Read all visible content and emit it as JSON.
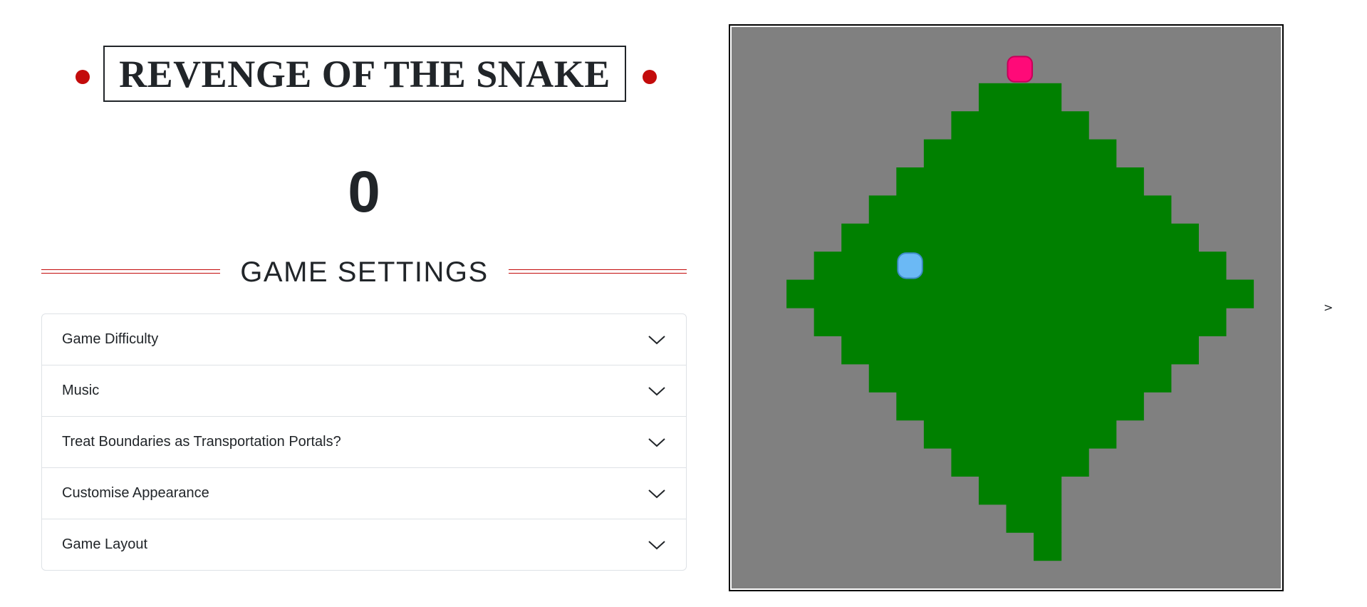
{
  "title": "REVENGE OF THE SNAKE",
  "score": "0",
  "settings": {
    "heading": "GAME SETTINGS",
    "items": [
      {
        "label": "Game Difficulty"
      },
      {
        "label": "Music"
      },
      {
        "label": "Treat Boundaries as Transportation Portals?"
      },
      {
        "label": "Customise Appearance"
      },
      {
        "label": "Game Layout"
      }
    ]
  },
  "board": {
    "cols": 20,
    "rows": 20,
    "background_color": "#808080",
    "snake_color": "#008000",
    "food_color": "#ff0a78",
    "player_color": "#6bb9f5",
    "snake_run_rows": [
      {
        "row": 2,
        "start": 9,
        "end": 11
      },
      {
        "row": 3,
        "start": 8,
        "end": 12
      },
      {
        "row": 4,
        "start": 7,
        "end": 13
      },
      {
        "row": 5,
        "start": 6,
        "end": 14
      },
      {
        "row": 6,
        "start": 5,
        "end": 15
      },
      {
        "row": 7,
        "start": 4,
        "end": 16
      },
      {
        "row": 8,
        "start": 3,
        "end": 17
      },
      {
        "row": 9,
        "start": 2,
        "end": 18
      },
      {
        "row": 10,
        "start": 3,
        "end": 17
      },
      {
        "row": 11,
        "start": 4,
        "end": 16
      },
      {
        "row": 12,
        "start": 5,
        "end": 15
      },
      {
        "row": 13,
        "start": 6,
        "end": 14
      },
      {
        "row": 14,
        "start": 7,
        "end": 13
      },
      {
        "row": 15,
        "start": 8,
        "end": 12
      },
      {
        "row": 16,
        "start": 9,
        "end": 11
      },
      {
        "row": 17,
        "start": 10,
        "end": 11
      },
      {
        "row": 18,
        "start": 11,
        "end": 11
      }
    ],
    "extra_snake_cells": [
      {
        "row": 9,
        "col": 18
      }
    ],
    "food": {
      "row": 1,
      "col": 10
    },
    "player": {
      "row": 8,
      "col": 6
    }
  },
  "next_arrow": ">"
}
